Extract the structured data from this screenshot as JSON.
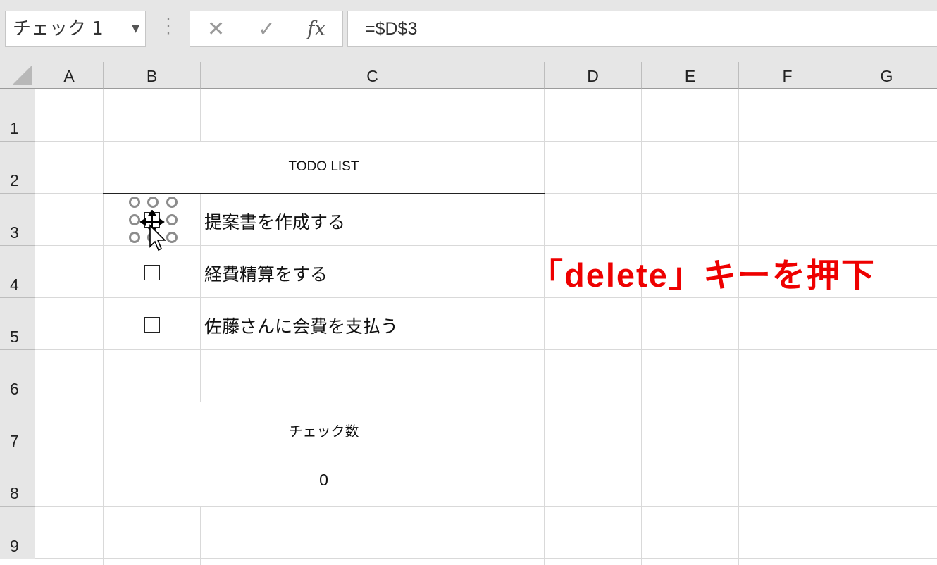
{
  "formula_bar": {
    "name_box": "チェック 1",
    "formula": "=$D$3",
    "cancel_symbol": "✕",
    "enter_symbol": "✓",
    "fx_label": "fx"
  },
  "columns": [
    "A",
    "B",
    "C",
    "D",
    "E",
    "F",
    "G"
  ],
  "rows": [
    "1",
    "2",
    "3",
    "4",
    "5",
    "6",
    "7",
    "8",
    "9"
  ],
  "sheet": {
    "todo_title": "TODO LIST",
    "tasks": [
      "提案書を作成する",
      "経費精算をする",
      "佐藤さんに会費を支払う"
    ],
    "count_title": "チェック数",
    "count_value": "0"
  },
  "annotation": "「delete」キーを押下",
  "colors": {
    "annotation": "#ee0000",
    "header_bg": "#e6e6e6",
    "gridline": "#d9d9d9"
  }
}
